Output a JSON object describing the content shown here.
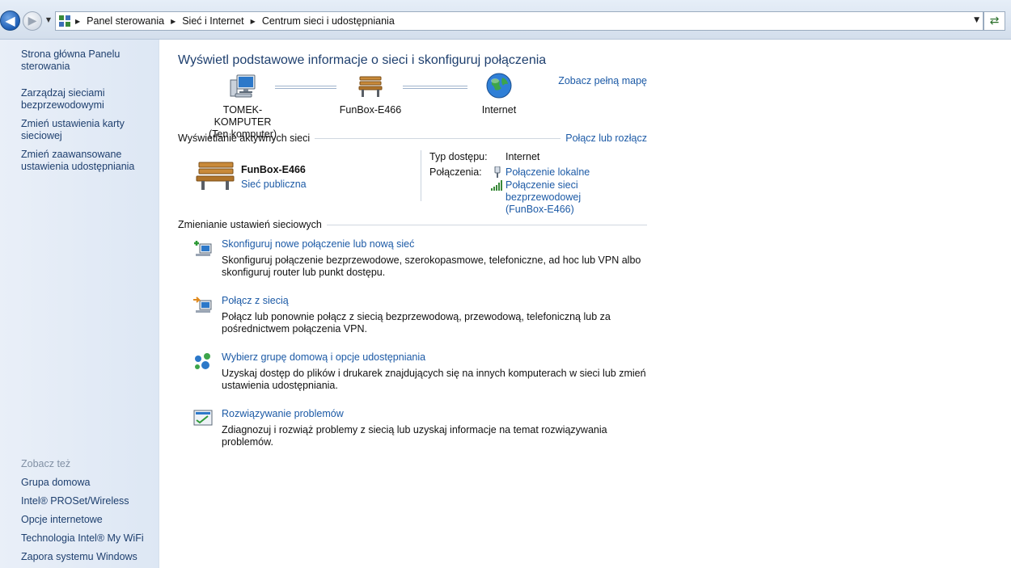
{
  "address_bar": {
    "breadcrumbs": [
      "Panel sterowania",
      "Sieć i Internet",
      "Centrum sieci i udostępniania"
    ]
  },
  "sidebar": {
    "links": [
      "Strona główna Panelu sterowania",
      "Zarządzaj sieciami bezprzewodowymi",
      "Zmień ustawienia karty sieciowej",
      "Zmień zaawansowane ustawienia udostępniania"
    ],
    "see_also_heading": "Zobacz też",
    "see_also": [
      "Grupa domowa",
      "Intel® PROSet/Wireless",
      "Opcje internetowe",
      "Technologia Intel® My WiFi",
      "Zapora systemu Windows"
    ]
  },
  "main": {
    "title": "Wyświetl podstawowe informacje o sieci i skonfiguruj połączenia",
    "full_map_link": "Zobacz pełną mapę",
    "map": {
      "computer_name": "TOMEK-KOMPUTER",
      "computer_sub": "(Ten komputer)",
      "network_name": "FunBox-E466",
      "internet_label": "Internet"
    },
    "active_networks": {
      "heading": "Wyświetlanie aktywnych sieci",
      "connect_link": "Połącz lub rozłącz",
      "network_name": "FunBox-E466",
      "network_type": "Sieć publiczna",
      "access_type_label": "Typ dostępu:",
      "access_type_value": "Internet",
      "connections_label": "Połączenia:",
      "connection_local": "Połączenie lokalne",
      "connection_wireless": "Połączenie sieci bezprzewodowej",
      "connection_wireless_ssid": "(FunBox-E466)"
    },
    "change_settings": {
      "heading": "Zmienianie ustawień sieciowych",
      "tasks": [
        {
          "title": "Skonfiguruj nowe połączenie lub nową sieć",
          "desc": "Skonfiguruj połączenie bezprzewodowe, szerokopasmowe, telefoniczne, ad hoc lub VPN albo skonfiguruj router lub punkt dostępu."
        },
        {
          "title": "Połącz z siecią",
          "desc": "Połącz lub ponownie połącz z siecią bezprzewodową, przewodową, telefoniczną lub za pośrednictwem połączenia VPN."
        },
        {
          "title": "Wybierz grupę domową i opcje udostępniania",
          "desc": "Uzyskaj dostęp do plików i drukarek znajdujących się na innych komputerach w sieci lub zmień ustawienia udostępniania."
        },
        {
          "title": "Rozwiązywanie problemów",
          "desc": "Zdiagnozuj i rozwiąż problemy z siecią lub uzyskaj informacje na temat rozwiązywania problemów."
        }
      ]
    }
  }
}
